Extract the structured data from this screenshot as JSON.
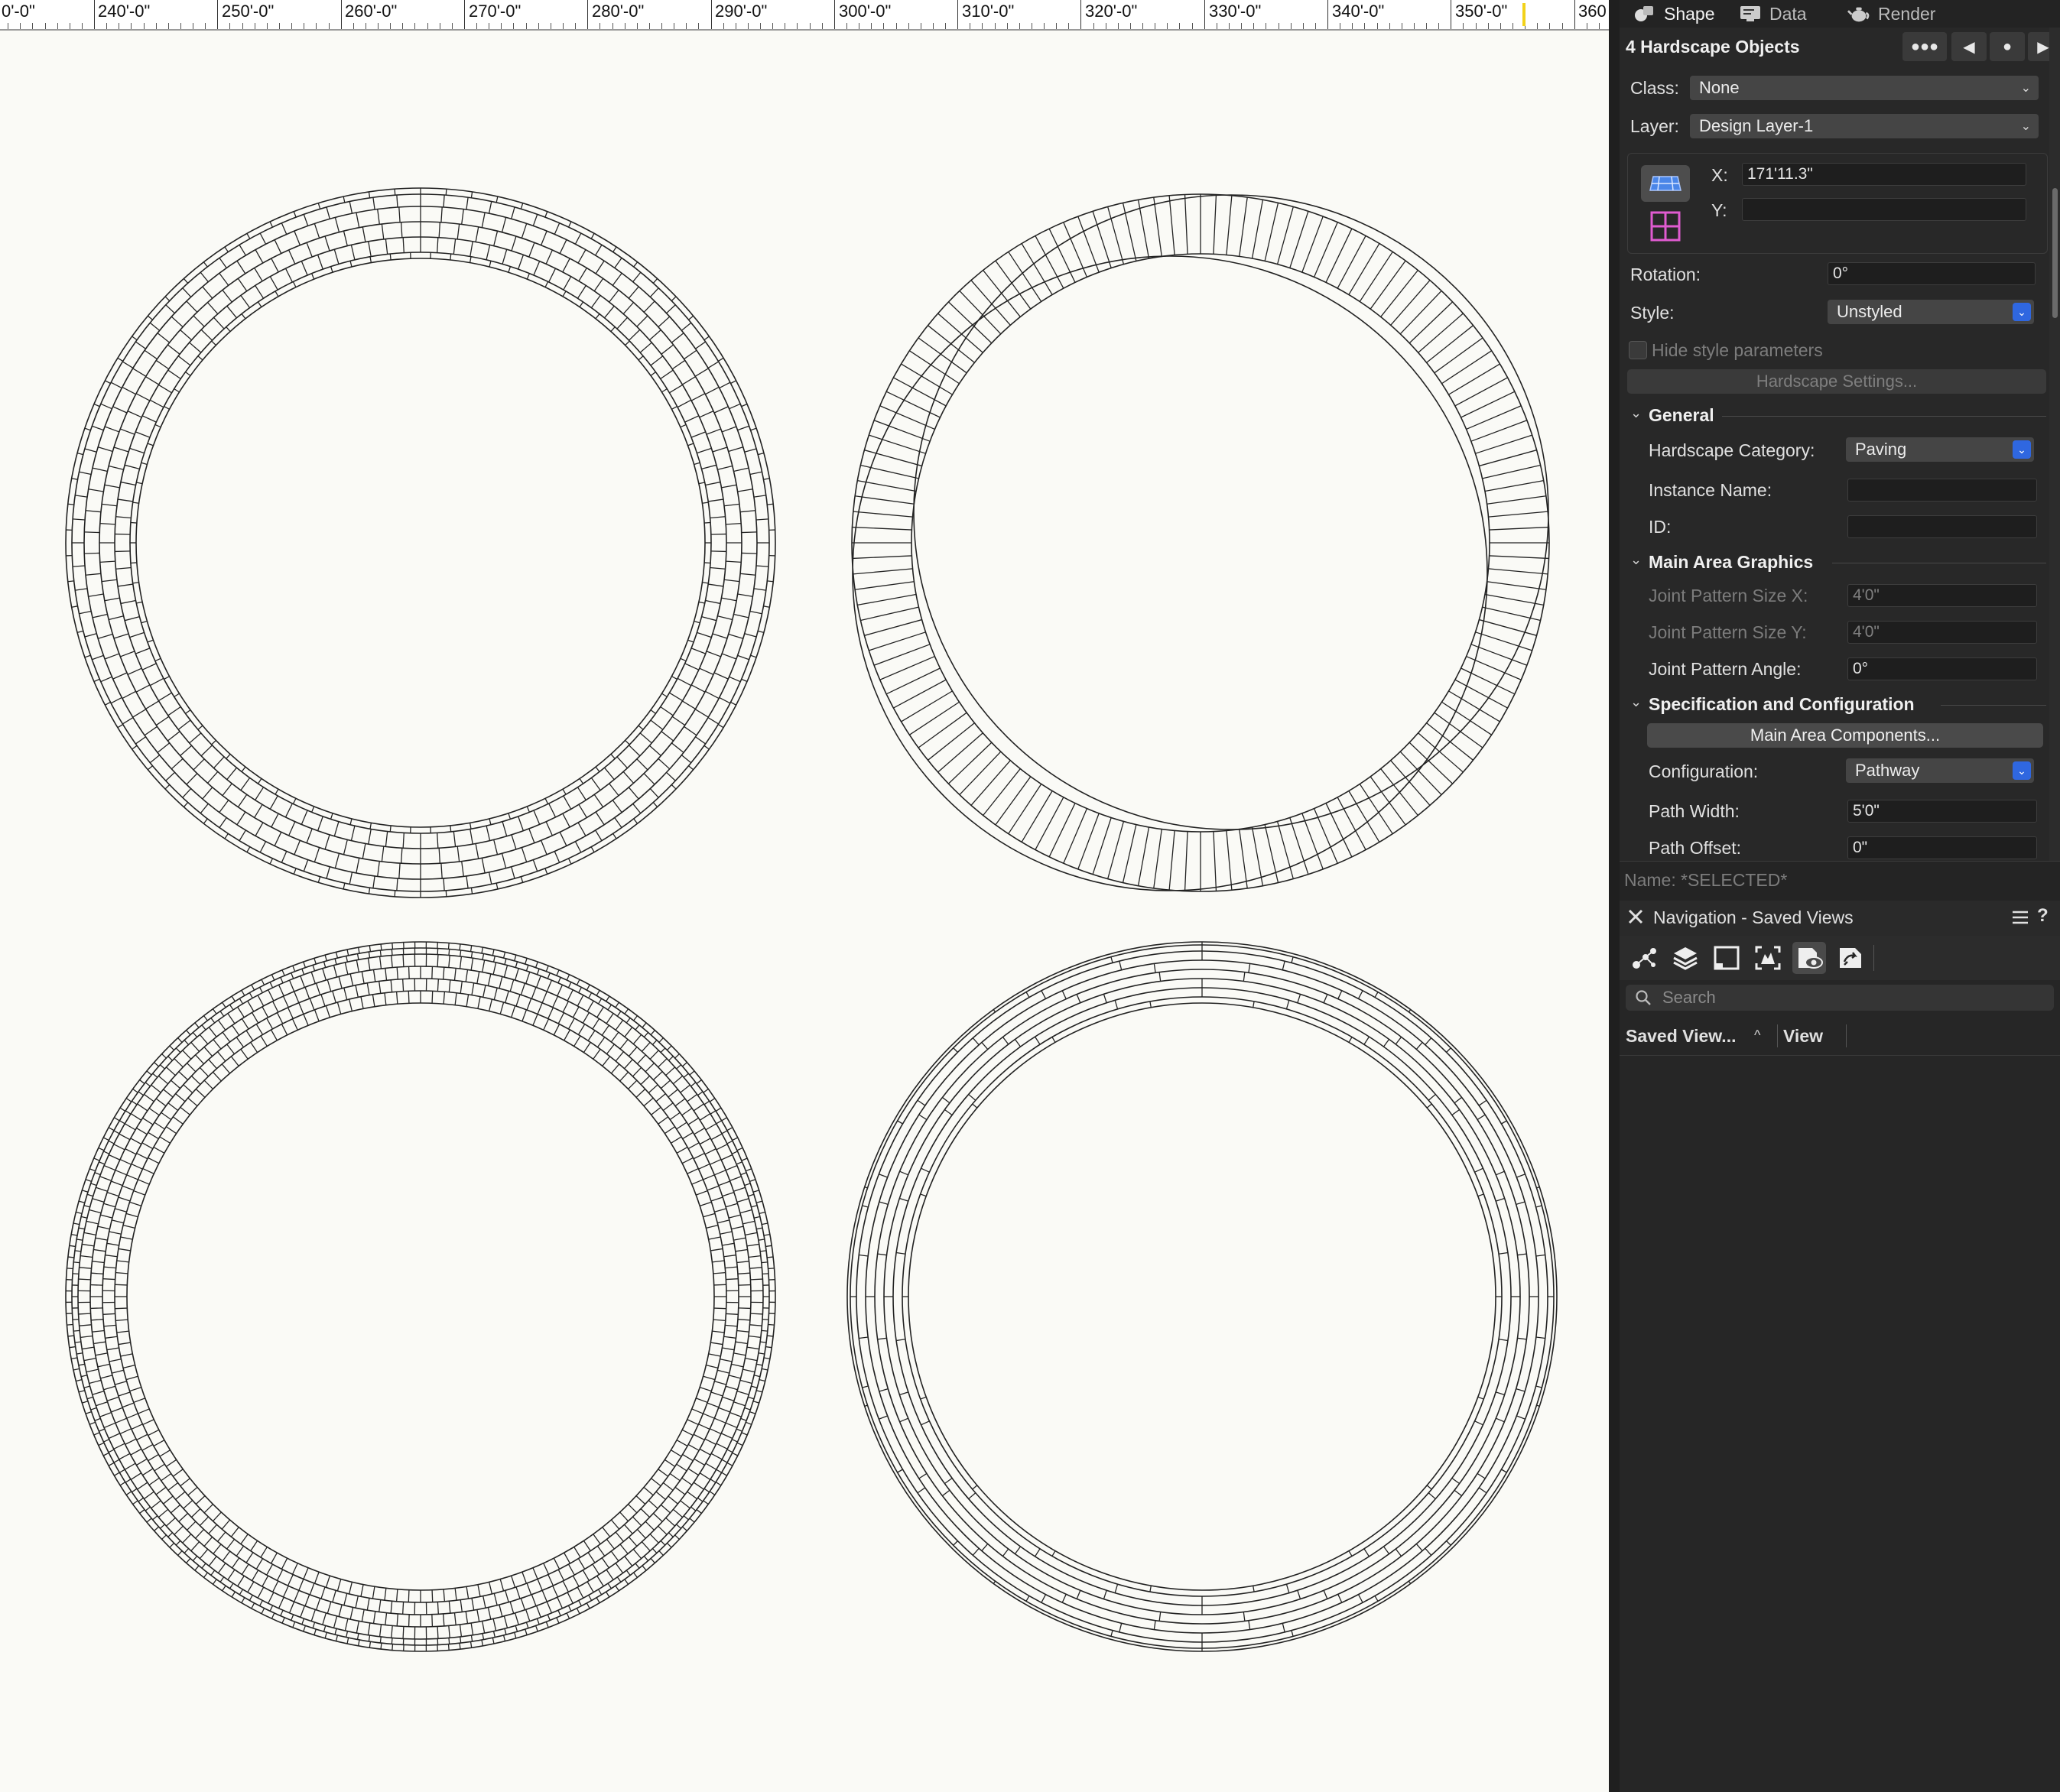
{
  "ruler": {
    "labels": [
      "0'-0\"",
      "240'-0\"",
      "250'-0\"",
      "260'-0\"",
      "270'-0\"",
      "280'-0\"",
      "290'-0\"",
      "300'-0\"",
      "310'-0\"",
      "320'-0\"",
      "330'-0\"",
      "340'-0\"",
      "350'-0\"",
      "360"
    ]
  },
  "tabs": {
    "shape": "Shape",
    "data": "Data",
    "render": "Render"
  },
  "object_info": {
    "title": "4 Hardscape Objects",
    "class_label": "Class:",
    "class_value": "None",
    "layer_label": "Layer:",
    "layer_value": "Design Layer-1",
    "x_label": "X:",
    "x_value": "171'11.3\"",
    "y_label": "Y:",
    "y_value": "",
    "rotation_label": "Rotation:",
    "rotation_value": "0°",
    "style_label": "Style:",
    "style_value": "Unstyled",
    "hide_style_label": "Hide style parameters",
    "hardscape_settings_label": "Hardscape Settings...",
    "general_section": "General",
    "hardscape_category_label": "Hardscape Category:",
    "hardscape_category_value": "Paving",
    "instance_name_label": "Instance Name:",
    "instance_name_value": "",
    "id_label": "ID:",
    "id_value": "",
    "main_area_section": "Main Area Graphics",
    "joint_x_label": "Joint Pattern Size X:",
    "joint_x_value": "4'0\"",
    "joint_y_label": "Joint Pattern Size Y:",
    "joint_y_value": "4'0\"",
    "joint_angle_label": "Joint Pattern Angle:",
    "joint_angle_value": "0°",
    "spec_section": "Specification and Configuration",
    "main_area_components_label": "Main Area Components...",
    "configuration_label": "Configuration:",
    "configuration_value": "Pathway",
    "path_width_label": "Path Width:",
    "path_width_value": "5'0\"",
    "path_offset_label": "Path Offset:",
    "path_offset_value": "0\"",
    "name_label": "Name:",
    "name_value": "*SELECTED*"
  },
  "navigation": {
    "title": "Navigation - Saved Views",
    "search_placeholder": "Search",
    "col_saved_view": "Saved View...",
    "col_view": "View"
  },
  "icons": {
    "close": "close-icon",
    "menu": "menu-icon",
    "help": "help-icon",
    "search": "search-icon"
  }
}
